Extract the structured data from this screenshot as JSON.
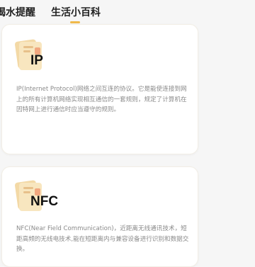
{
  "tabs": [
    {
      "label": "喝水提醒",
      "active": false
    },
    {
      "label": "生活小百科",
      "active": true
    }
  ],
  "accent_color": "#f0b94a",
  "cards": [
    {
      "icon": "file-folder-icon",
      "title": "IP",
      "description": "IP(Internet Protocol)网络之间互连的协议。它是能使连接到网上的所有计算机网络实现相互通信的一套规则，规定了计算机在因特网上进行通信时应当遵守的规则。"
    },
    {
      "icon": "file-folder-icon",
      "title": "NFC",
      "description": "NFC(Near Field Communication)，近距离无线通讯技术，短距高频的无线电技术,能在短距离内与兼容设备进行识别和数据交换。"
    }
  ]
}
